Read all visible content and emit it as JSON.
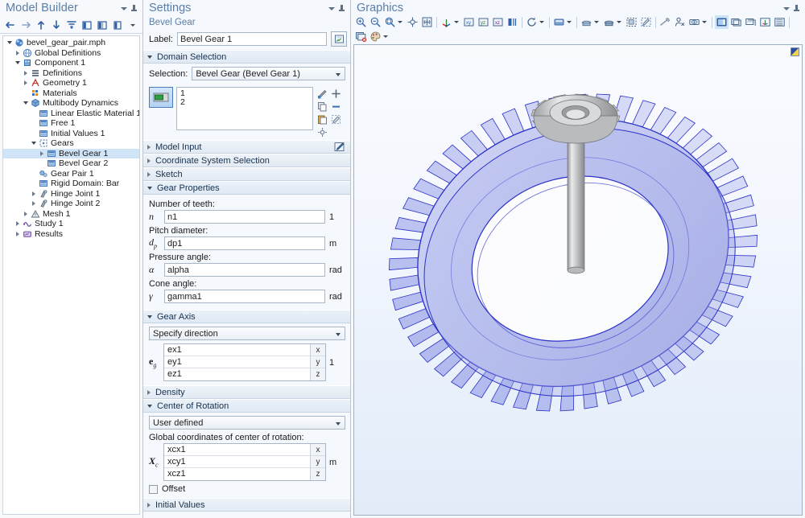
{
  "model_builder": {
    "title": "Model Builder",
    "toolbar": [
      {
        "name": "back-button",
        "icon": "arrow-left-icon"
      },
      {
        "name": "forward-button",
        "icon": "arrow-right-icon"
      },
      {
        "name": "move-up-button",
        "icon": "arrow-up-icon"
      },
      {
        "name": "move-down-button",
        "icon": "arrow-down-icon"
      },
      {
        "name": "collapse-all-button",
        "icon": "collapse-icon"
      },
      {
        "name": "show-button",
        "icon": "panel-left-icon"
      },
      {
        "name": "show-more-options-button",
        "icon": "panel-right-icon"
      },
      {
        "name": "node-display-button",
        "icon": "panel-icon"
      }
    ],
    "tree": [
      {
        "label": "bevel_gear_pair.mph",
        "depth": 0,
        "expander": "down",
        "icon": "root-icon",
        "selected": false
      },
      {
        "label": "Global Definitions",
        "depth": 1,
        "expander": "right",
        "icon": "globe-icon",
        "selected": false
      },
      {
        "label": "Component 1",
        "depth": 1,
        "expander": "down",
        "icon": "component-icon",
        "selected": false
      },
      {
        "label": "Definitions",
        "depth": 2,
        "expander": "right",
        "icon": "definitions-icon",
        "selected": false
      },
      {
        "label": "Geometry 1",
        "depth": 2,
        "expander": "right",
        "icon": "geometry-icon",
        "selected": false
      },
      {
        "label": "Materials",
        "depth": 2,
        "expander": "none",
        "icon": "materials-icon",
        "selected": false
      },
      {
        "label": "Multibody Dynamics",
        "depth": 2,
        "expander": "down",
        "icon": "physics-icon",
        "selected": false
      },
      {
        "label": "Linear Elastic Material 1",
        "depth": 3,
        "expander": "none",
        "icon": "domain-icon",
        "selected": false
      },
      {
        "label": "Free 1",
        "depth": 3,
        "expander": "none",
        "icon": "domain-icon",
        "selected": false
      },
      {
        "label": "Initial Values 1",
        "depth": 3,
        "expander": "none",
        "icon": "domain-icon",
        "selected": false
      },
      {
        "label": "Gears",
        "depth": 3,
        "expander": "down",
        "icon": "gears-icon",
        "selected": false
      },
      {
        "label": "Bevel Gear 1",
        "depth": 4,
        "expander": "right",
        "icon": "domain-icon",
        "selected": true
      },
      {
        "label": "Bevel Gear 2",
        "depth": 4,
        "expander": "none",
        "icon": "domain-icon",
        "selected": false
      },
      {
        "label": "Gear Pair 1",
        "depth": 3,
        "expander": "none",
        "icon": "gearpair-icon",
        "selected": false
      },
      {
        "label": "Rigid Domain: Bar",
        "depth": 3,
        "expander": "none",
        "icon": "domain-icon",
        "selected": false
      },
      {
        "label": "Hinge Joint 1",
        "depth": 3,
        "expander": "right",
        "icon": "joint-icon",
        "selected": false
      },
      {
        "label": "Hinge Joint 2",
        "depth": 3,
        "expander": "right",
        "icon": "joint-icon",
        "selected": false
      },
      {
        "label": "Mesh 1",
        "depth": 2,
        "expander": "right",
        "icon": "mesh-icon",
        "selected": false
      },
      {
        "label": "Study 1",
        "depth": 1,
        "expander": "right",
        "icon": "study-icon",
        "selected": false
      },
      {
        "label": "Results",
        "depth": 1,
        "expander": "right",
        "icon": "results-icon",
        "selected": false
      }
    ]
  },
  "settings": {
    "title": "Settings",
    "subtitle": "Bevel Gear",
    "label_caption": "Label:",
    "label_value": "Bevel Gear 1",
    "sections": {
      "domain_selection": {
        "title": "Domain Selection",
        "expanded": true,
        "selection_caption": "Selection:",
        "selection_value": "Bevel Gear (Bevel Gear 1)",
        "entities": [
          "1",
          "2"
        ]
      },
      "model_input": {
        "title": "Model Input",
        "expanded": false
      },
      "coordinate_system_selection": {
        "title": "Coordinate System Selection",
        "expanded": false
      },
      "sketch": {
        "title": "Sketch",
        "expanded": false
      },
      "gear_properties": {
        "title": "Gear Properties",
        "expanded": true,
        "fields": [
          {
            "caption": "Number of teeth:",
            "symbol": "n",
            "sub": "",
            "value": "n1",
            "unit": "1"
          },
          {
            "caption": "Pitch diameter:",
            "symbol": "d",
            "sub": "p",
            "value": "dp1",
            "unit": "m"
          },
          {
            "caption": "Pressure angle:",
            "symbol": "α",
            "sub": "",
            "value": "alpha",
            "unit": "rad"
          },
          {
            "caption": "Cone angle:",
            "symbol": "γ",
            "sub": "",
            "value": "gamma1",
            "unit": "rad"
          }
        ]
      },
      "gear_axis": {
        "title": "Gear Axis",
        "expanded": true,
        "mode": "Specify direction",
        "symbol": "e",
        "sub": "g",
        "unit": "1",
        "rows": [
          {
            "value": "ex1",
            "axis": "x"
          },
          {
            "value": "ey1",
            "axis": "y"
          },
          {
            "value": "ez1",
            "axis": "z"
          }
        ]
      },
      "density": {
        "title": "Density",
        "expanded": false
      },
      "center_of_rotation": {
        "title": "Center of Rotation",
        "expanded": true,
        "mode": "User defined",
        "coords_caption": "Global coordinates of center of rotation:",
        "symbol": "X",
        "sub": "c",
        "unit": "m",
        "rows": [
          {
            "value": "xcx1",
            "axis": "x"
          },
          {
            "value": "xcy1",
            "axis": "y"
          },
          {
            "value": "xcz1",
            "axis": "z"
          }
        ],
        "offset_label": "Offset",
        "offset_checked": false
      },
      "initial_values": {
        "title": "Initial Values",
        "expanded": false
      }
    }
  },
  "graphics": {
    "title": "Graphics",
    "toolbar_row1": [
      {
        "name": "zoom-in-button",
        "icon": "zoom-in-icon"
      },
      {
        "name": "zoom-out-button",
        "icon": "zoom-out-icon"
      },
      {
        "name": "zoom-extents-button",
        "icon": "zoom-extents-icon",
        "dropdown": true
      },
      {
        "name": "zoom-to-selection-button",
        "icon": "crosshair-icon"
      },
      {
        "name": "zoom-box-button",
        "icon": "zoom-box-icon"
      },
      {
        "sep": true
      },
      {
        "name": "go-to-default-view-button",
        "icon": "axes-icon",
        "dropdown": true
      },
      {
        "name": "go-to-xy-view-button",
        "icon": "xy-view-icon"
      },
      {
        "name": "go-to-yz-view-button",
        "icon": "yz-view-icon"
      },
      {
        "name": "go-to-xz-view-button",
        "icon": "xz-view-icon"
      },
      {
        "name": "flip-view-button",
        "icon": "flip-icon"
      },
      {
        "sep": true
      },
      {
        "name": "rotate-button",
        "icon": "rotate-icon",
        "dropdown": true
      },
      {
        "sep": true
      },
      {
        "name": "scene-light-button",
        "icon": "scene-light-icon",
        "dropdown": true
      },
      {
        "sep": true
      },
      {
        "name": "select-box-button",
        "icon": "select-box-icon",
        "dropdown": true
      },
      {
        "name": "select-lasso-button",
        "icon": "select-lasso-icon",
        "dropdown": true
      },
      {
        "name": "select-rectangle-button",
        "icon": "select-rect-icon"
      },
      {
        "name": "deselect-button",
        "icon": "deselect-icon"
      },
      {
        "sep": true
      },
      {
        "name": "hide-button",
        "icon": "hide-icon"
      },
      {
        "name": "hide-selected-button",
        "icon": "hide-person-icon"
      },
      {
        "name": "view-hidden-button",
        "icon": "eye-icon",
        "dropdown": true
      },
      {
        "sep": true
      },
      {
        "name": "transparency-button",
        "icon": "transparency-icon",
        "active": true
      },
      {
        "name": "wireframe-rendering-button",
        "icon": "wireframe-icon"
      },
      {
        "name": "show-grid-button",
        "icon": "grid-icon"
      },
      {
        "name": "show-axis-button",
        "icon": "axis-orient-icon"
      },
      {
        "name": "show-legend-button",
        "icon": "legend-icon"
      },
      {
        "sep": true
      },
      {
        "name": "clear-plot-button",
        "icon": "clear-plot-icon"
      },
      {
        "name": "color-theme-button",
        "icon": "palette-icon",
        "dropdown": true
      }
    ],
    "toolbar_row2": [
      {
        "name": "refresh-button",
        "icon": "refresh-icon",
        "dropdown": true
      },
      {
        "name": "snapshot-button",
        "icon": "camera-icon"
      },
      {
        "name": "print-button",
        "icon": "printer-icon"
      }
    ],
    "scene": {
      "description": "3D bevel gear pair: large transparent blue ring gear meshing with a small grey pinion gear on a vertical shaft",
      "ring_gear_color": "#9aa3e8",
      "ring_gear_edge_color": "#2b31c8",
      "pinion_color": "#c8cacb",
      "shaft_color": "#c9cbcc",
      "background_top": "#fafbff",
      "background_bottom": "#e2ecf9",
      "ring_gear_teeth": 48,
      "pinion_teeth": 12
    }
  },
  "colors": {
    "accent": "#5b7ea8",
    "selection": "#cfe4f7",
    "panel_bg": "#f5f8fc",
    "border": "#b9c6d4"
  }
}
